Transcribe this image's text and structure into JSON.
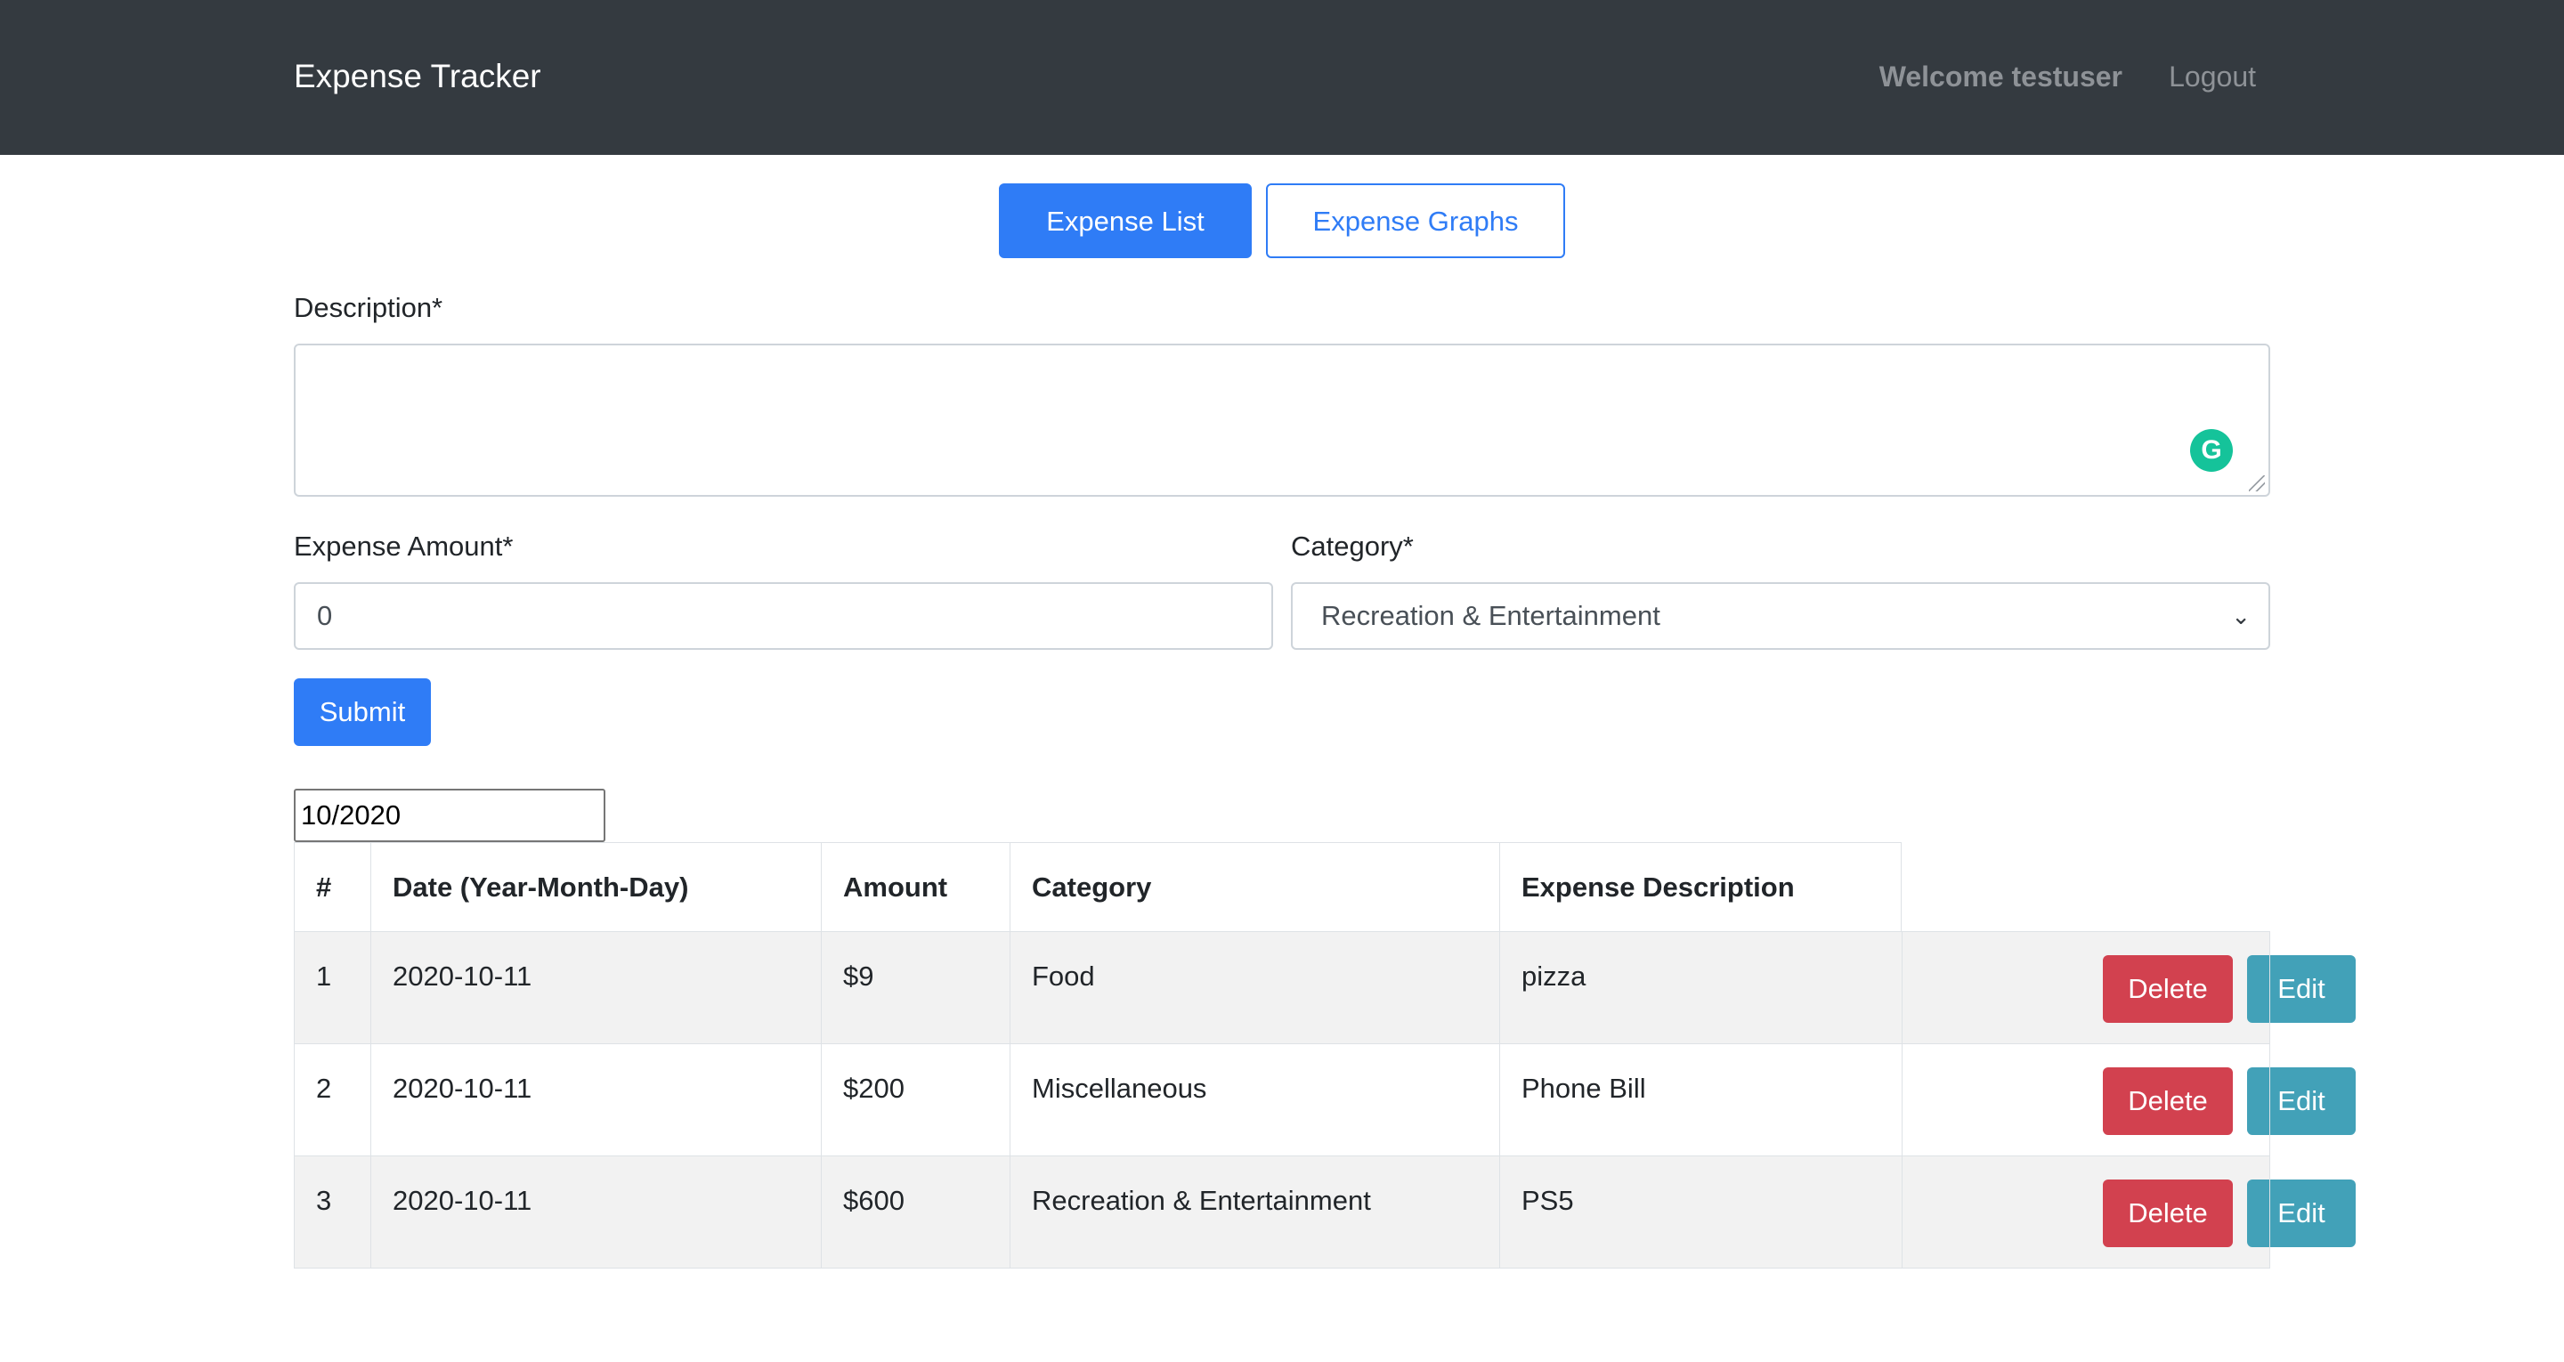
{
  "navbar": {
    "brand": "Expense Tracker",
    "welcome": "Welcome testuser",
    "logout": "Logout",
    "background": "#343a40"
  },
  "tabs": [
    {
      "label": "Expense List",
      "active": true
    },
    {
      "label": "Expense Graphs",
      "active": false
    }
  ],
  "form": {
    "description_label": "Description*",
    "description_value": "",
    "grammarly_icon": "G",
    "amount_label": "Expense Amount*",
    "amount_value": "0",
    "category_label": "Category*",
    "category_value": "Recreation & Entertainment",
    "submit_label": "Submit"
  },
  "filter": {
    "month_value": "10/2020"
  },
  "table": {
    "headers": [
      "#",
      "Date (Year-Month-Day)",
      "Amount",
      "Category",
      "Expense Description"
    ],
    "rows": [
      {
        "num": "1",
        "date": "2020-10-11",
        "amount": "$9",
        "category": "Food",
        "description": "pizza",
        "delete": "Delete",
        "edit": "Edit"
      },
      {
        "num": "2",
        "date": "2020-10-11",
        "amount": "$200",
        "category": "Miscellaneous",
        "description": "Phone Bill",
        "delete": "Delete",
        "edit": "Edit"
      },
      {
        "num": "3",
        "date": "2020-10-11",
        "amount": "$600",
        "category": "Recreation & Entertainment",
        "description": "PS5",
        "delete": "Delete",
        "edit": "Edit"
      }
    ]
  },
  "colors": {
    "primary": "#2f7cf6",
    "danger": "#d2414f",
    "info": "#42a1b8"
  }
}
